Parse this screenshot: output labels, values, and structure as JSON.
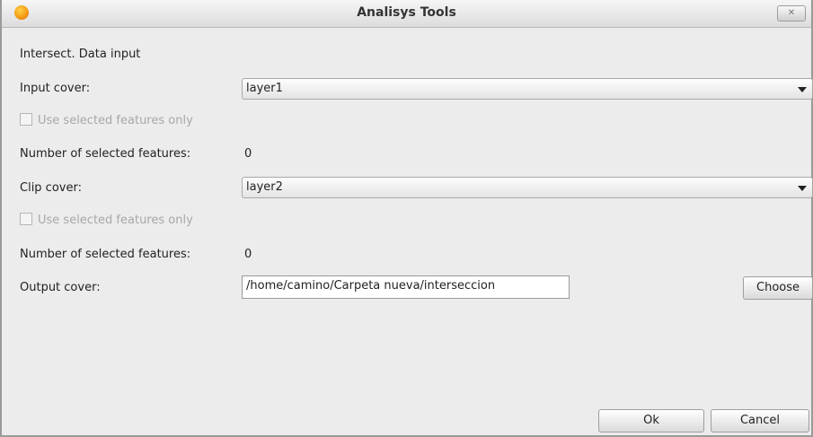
{
  "window": {
    "title": "Analisys Tools"
  },
  "form": {
    "section_label": "Intersect. Data input",
    "input_cover": {
      "label": "Input cover:",
      "value": "layer1"
    },
    "input_selected_only": {
      "label": "Use selected features only",
      "checked": false
    },
    "input_num_selected": {
      "label": "Number of selected features:",
      "value": "0"
    },
    "clip_cover": {
      "label": "Clip cover:",
      "value": "layer2"
    },
    "clip_selected_only": {
      "label": "Use selected features only",
      "checked": false
    },
    "clip_num_selected": {
      "label": "Number of selected features:",
      "value": "0"
    },
    "output_cover": {
      "label": "Output cover:",
      "value": "/home/camino/Carpeta nueva/interseccion"
    }
  },
  "buttons": {
    "choose": "Choose",
    "ok": "Ok",
    "cancel": "Cancel"
  },
  "colors": {
    "window_bg": "#ececec",
    "app_icon": "#f59b17"
  }
}
